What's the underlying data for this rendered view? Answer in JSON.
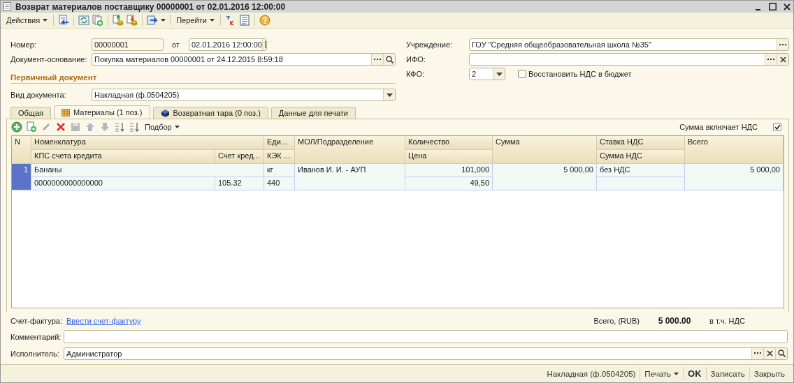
{
  "window": {
    "title": "Возврат материалов поставщику 00000001 от 02.01.2016 12:00:00"
  },
  "toolbar": {
    "actions_menu": "Действия",
    "goto_menu": "Перейти"
  },
  "number": {
    "label": "Номер:",
    "value": "00000001"
  },
  "date": {
    "label": "от",
    "value": "02.01.2016 12:00:00"
  },
  "base_document": {
    "label": "Документ-основание:",
    "value": "Покупка материалов 00000001 от 24.12.2015 8:59:18"
  },
  "primary_section": "Первичный документ",
  "document_kind": {
    "label": "Вид документа:",
    "value": "Накладная (ф.0504205)"
  },
  "institution": {
    "label": "Учреждение:",
    "value": "ГОУ \"Средняя общеобразовательная школа №35\""
  },
  "ifo": {
    "label": "ИФО:"
  },
  "kfo": {
    "label": "КФО:",
    "value": "2"
  },
  "restore_vat": {
    "label": "Восстановить НДС в бюджет",
    "checked": false
  },
  "tabs": [
    {
      "label": "Общая",
      "selected": false
    },
    {
      "label": "Материалы (1 поз.)",
      "selected": true
    },
    {
      "label": "Возвратная тара (0 поз.)",
      "selected": false
    },
    {
      "label": "Данные для печати",
      "selected": false
    }
  ],
  "table_toolbar": {
    "selection_menu": "Подбор",
    "sum_includes_vat": {
      "label": "Сумма включает НДС",
      "checked": true
    }
  },
  "table": {
    "header": {
      "n": "N",
      "nomenclature": "Номенклатура",
      "unit": "Еди...",
      "mol": "МОЛ/Подразделение",
      "quantity": "Количество",
      "sum": "Сумма",
      "vat_rate": "Ставка НДС",
      "total": "Всего",
      "kps": "КПС счета кредита",
      "credit_account": "Счет кред...",
      "kek": "КЭК ...",
      "price": "Цена",
      "vat_sum": "Сумма НДС"
    },
    "rows": [
      {
        "n": "1",
        "selected": true,
        "nomenclature": "Бананы",
        "unit": "кг",
        "mol": "Иванов И. И. - АУП",
        "quantity": "101,000",
        "sum": "5 000,00",
        "vat_rate": "без НДС",
        "total": "5 000,00",
        "kps": "0000000000000000",
        "credit_account": "105.32",
        "kek": "440",
        "price": "49,50"
      }
    ]
  },
  "invoice": {
    "label": "Счет-фактура:",
    "link": "Ввести счет-фактуру"
  },
  "totals": {
    "label": "Всего, (RUB)",
    "amount": "5 000.00",
    "vat_label": "в т.ч. НДС"
  },
  "comment": {
    "label": "Комментарий:"
  },
  "executor": {
    "label": "Исполнитель:",
    "value": "Администратор"
  },
  "footer": [
    {
      "kind": "link",
      "label": "Накладная (ф.0504205)"
    },
    {
      "kind": "menu",
      "label": "Печать"
    },
    {
      "kind": "default",
      "label": "OK"
    },
    {
      "kind": "button",
      "label": "Записать"
    },
    {
      "kind": "button",
      "label": "Закрыть"
    }
  ]
}
